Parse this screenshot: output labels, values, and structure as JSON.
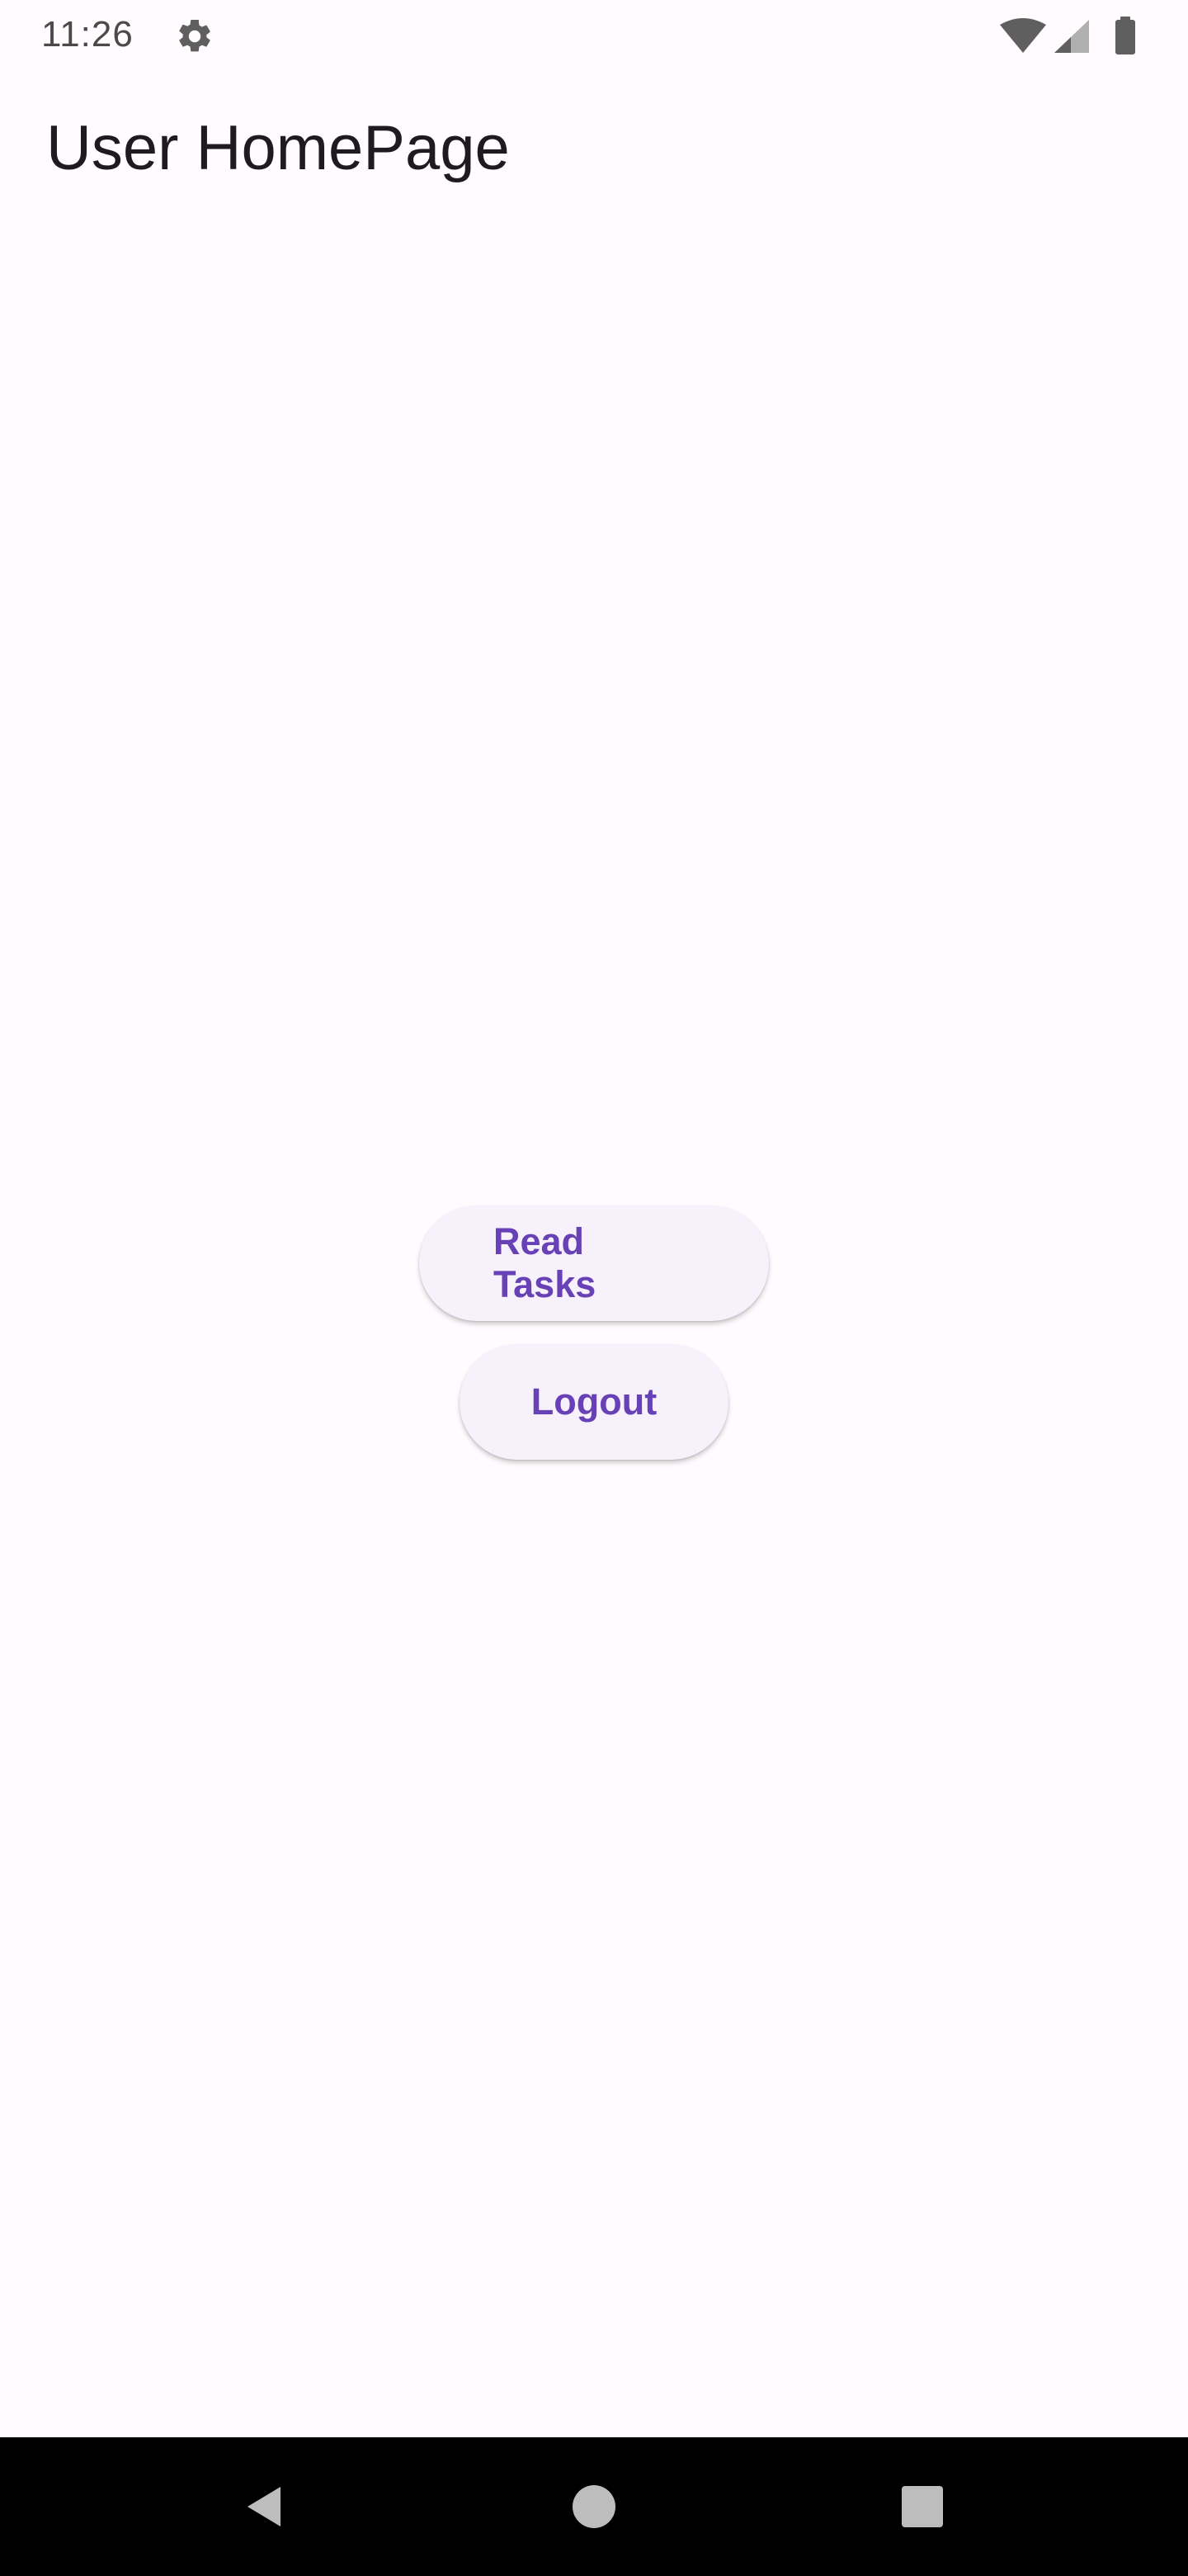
{
  "status_bar": {
    "time": "11:26",
    "icons": [
      "gear-icon",
      "wifi-icon",
      "cell-signal-icon",
      "battery-icon"
    ]
  },
  "app_bar": {
    "title": "User HomePage"
  },
  "actions": {
    "read_tasks_label": "Read Tasks",
    "logout_label": "Logout"
  },
  "nav_bar": {
    "icons": [
      "back-icon",
      "home-icon",
      "recent-apps-icon"
    ]
  },
  "colors": {
    "background": "#fffbfe",
    "button_background": "#f6f1fb",
    "button_text": "#6741b5",
    "title_text": "#1d1b20",
    "status_text": "#4a4a4a",
    "nav_background": "#000000",
    "nav_icon": "#bdbdbd"
  }
}
